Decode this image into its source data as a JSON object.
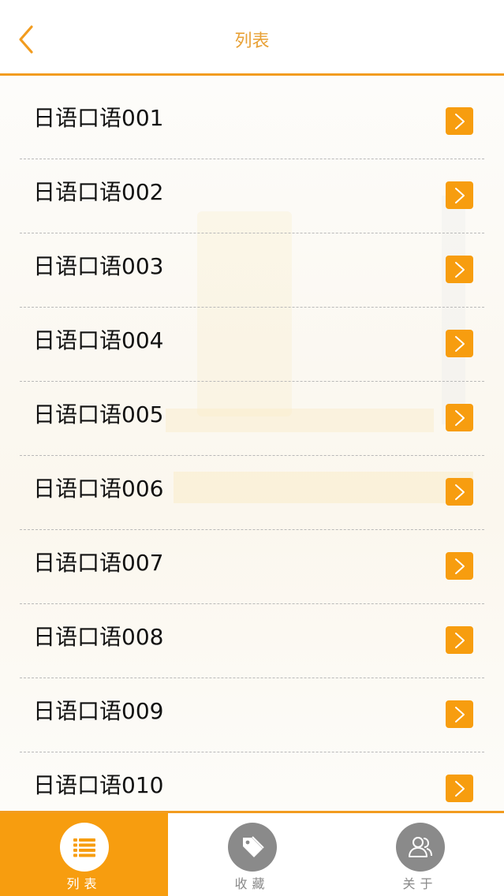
{
  "header": {
    "title": "列表"
  },
  "list": [
    {
      "label": "日语口语001"
    },
    {
      "label": "日语口语002"
    },
    {
      "label": "日语口语003"
    },
    {
      "label": "日语口语004"
    },
    {
      "label": "日语口语005"
    },
    {
      "label": "日语口语006"
    },
    {
      "label": "日语口语007"
    },
    {
      "label": "日语口语008"
    },
    {
      "label": "日语口语009"
    },
    {
      "label": "日语口语010"
    }
  ],
  "tabs": [
    {
      "label": "列表",
      "icon": "list-icon",
      "active": true
    },
    {
      "label": "收藏",
      "icon": "tag-icon",
      "active": false
    },
    {
      "label": "关于",
      "icon": "users-icon",
      "active": false
    }
  ],
  "colors": {
    "accent": "#f79d0f",
    "title": "#e8a136",
    "inactive": "#8a8a8a"
  }
}
